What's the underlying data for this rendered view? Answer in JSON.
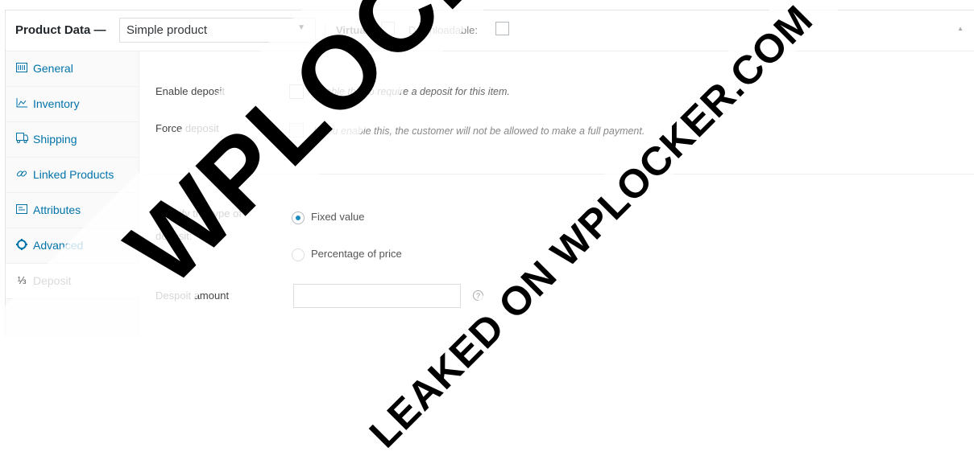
{
  "header": {
    "title": "Product Data —",
    "product_type": "Simple product",
    "virtual_label": "Virtual:",
    "downloadable_label": "Downloadable:",
    "collapse_icon": "triangle-up-icon"
  },
  "tabs": [
    {
      "label": "General",
      "icon": "general-icon"
    },
    {
      "label": "Inventory",
      "icon": "inventory-icon"
    },
    {
      "label": "Shipping",
      "icon": "shipping-icon"
    },
    {
      "label": "Linked Products",
      "icon": "link-icon"
    },
    {
      "label": "Attributes",
      "icon": "attributes-icon"
    },
    {
      "label": "Advanced",
      "icon": "gear-icon"
    },
    {
      "label": "Deposit",
      "icon": "fraction-icon",
      "icon_glyph": "⅓",
      "active": true
    }
  ],
  "deposit": {
    "enable_label": "Enable deposit",
    "enable_desc": "Enable this to require a deposit for this item.",
    "force_label": "Force deposit",
    "force_desc": "If you enable this, the customer will not be allowed to make a full payment.",
    "type_label": "Specify the type of deposit:",
    "type_options": [
      {
        "label": "Fixed value",
        "selected": true
      },
      {
        "label": "Percentage of price",
        "selected": false
      }
    ],
    "amount_label": "Despoit amount",
    "help_icon": "question-icon"
  },
  "watermark": {
    "main": "WPLOCKER.COM",
    "secondary": "LEAKED ON WPLOCKER.COM"
  },
  "colors": {
    "link": "#0073aa",
    "radio_selected": "#1e8cbe"
  }
}
